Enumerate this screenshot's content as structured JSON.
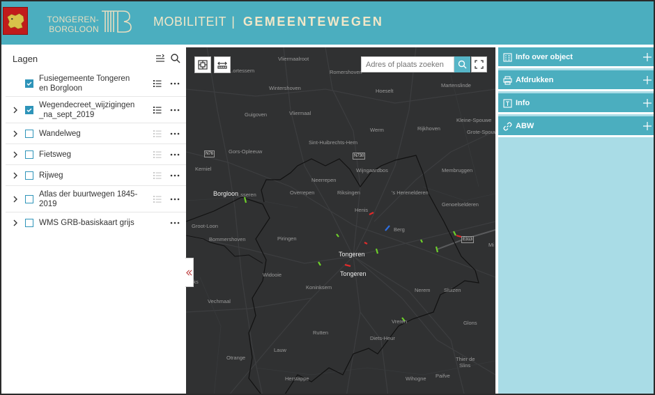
{
  "header": {
    "brand_line1": "TONGEREN-",
    "brand_line2": "BORGLOON",
    "title_left": "MOBILITEIT",
    "title_sep": "|",
    "title_right": "GEMEENTEWEGEN",
    "colors": {
      "bar": "#4baebf",
      "text": "#f1e7c8",
      "flag": "#c11b1b"
    }
  },
  "layers_panel": {
    "title": "Lagen",
    "items": [
      {
        "label_line1": "Fusiegemeente Tongeren",
        "label_line2": "en Borgloon",
        "checked": true,
        "expandable": false,
        "legend": true
      },
      {
        "label_line1": "Wegendecreet_wijzigingen",
        "label_line2": "_na_sept_2019",
        "checked": true,
        "expandable": true,
        "legend": true
      },
      {
        "label_line1": "Wandelweg",
        "label_line2": "",
        "checked": false,
        "expandable": true,
        "legend": true
      },
      {
        "label_line1": "Fietsweg",
        "label_line2": "",
        "checked": false,
        "expandable": true,
        "legend": true
      },
      {
        "label_line1": "Rijweg",
        "label_line2": "",
        "checked": false,
        "expandable": true,
        "legend": true
      },
      {
        "label_line1": "Atlas der buurtwegen 1845-",
        "label_line2": "2019",
        "checked": false,
        "expandable": true,
        "legend": true
      },
      {
        "label_line1": "WMS GRB-basiskaart grijs",
        "label_line2": "",
        "checked": false,
        "expandable": true,
        "legend": false
      }
    ]
  },
  "map": {
    "search_placeholder": "Adres of plaats zoeken",
    "places": {
      "vliermaalroot": "Vliermaalroot",
      "romershoven": "Romershoven",
      "hoeselt": "Hoeselt",
      "martenslinde": "Martenslinde",
      "wintershoven": "Wintershoven",
      "guigoven": "Guigoven",
      "vliermaal": "Vliermaal",
      "rijkhoven": "Rijkhoven",
      "kleine_spouwen": "Kleine-Spouwe",
      "grote_spouwen": "Grote-Spouw",
      "werm": "Werm",
      "gors_opleeuw": "Gors-Opleeuw",
      "sint_huibrechts_hern": "Sint-Huibrechts-Hern",
      "kerniel": "Kerniel",
      "wijngaardbos": "Wijngaardbos",
      "membruggen": "Membruggen",
      "neerrepen": "Neerrepen",
      "borgloon": "Borgloon",
      "bisseren": "...sseren",
      "overrepen": "Overrepen",
      "riksingen": "Riksingen",
      "s_herenelderen": "'s Herenelderen",
      "genoelselderen": "Genoelselderen",
      "henis": "Henis",
      "groot_loon": "Groot-Loon",
      "berg": "Berg",
      "bommershoven": "Bommershoven",
      "piringen": "Piringen",
      "tongeren_1": "Tongeren",
      "tongeren_2": "Tongeren",
      "widooie": "Widooie",
      "koninksem": "Koninksem",
      "nerem": "Nerem",
      "sluizen": "Sluizen",
      "vechmaal": "Vechmaal",
      "vreren": "Vreren",
      "glons": "Glons",
      "rutten": "Rutten",
      "diets_heur": "Diets-Heur",
      "lauw": "Lauw",
      "otrange": "Otrange",
      "thier_de_slins_1": "Thier de",
      "thier_de_slins_2": "Slins",
      "herstappe": "Herstappe",
      "wihogne": "Wihogne",
      "paifve": "Paifve",
      "nks": "...ks",
      "mi": "Mi",
      "ortessem": "...ortessem"
    },
    "road_shields": {
      "n76": "N76",
      "n730": "N730",
      "e313": "E313"
    }
  },
  "right_panel": {
    "items": [
      {
        "title": "Info over object",
        "icon": "info-object-icon"
      },
      {
        "title": "Afdrukken",
        "icon": "printer-icon"
      },
      {
        "title": "Info",
        "icon": "text-info-icon"
      },
      {
        "title": "ABW",
        "icon": "link-icon"
      }
    ]
  }
}
